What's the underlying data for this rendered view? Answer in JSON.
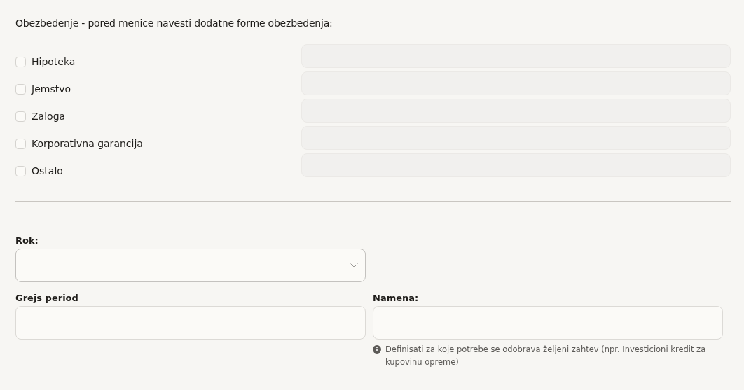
{
  "security": {
    "heading": "Obezbeđenje - pored menice navesti dodatne forme obezbeđenja:",
    "options": [
      {
        "label": "Hipoteka",
        "checked": false
      },
      {
        "label": "Jemstvo",
        "checked": false
      },
      {
        "label": "Zaloga",
        "checked": false
      },
      {
        "label": "Korporativna garancija",
        "checked": false
      },
      {
        "label": "Ostalo",
        "checked": false
      }
    ]
  },
  "rok": {
    "label": "Rok:"
  },
  "grace": {
    "label": "Grejs period"
  },
  "purpose": {
    "label": "Namena:",
    "help": "Definisati za koje potrebe se odobrava željeni zahtev (npr. Investicioni kredit za kupovinu opreme)"
  }
}
